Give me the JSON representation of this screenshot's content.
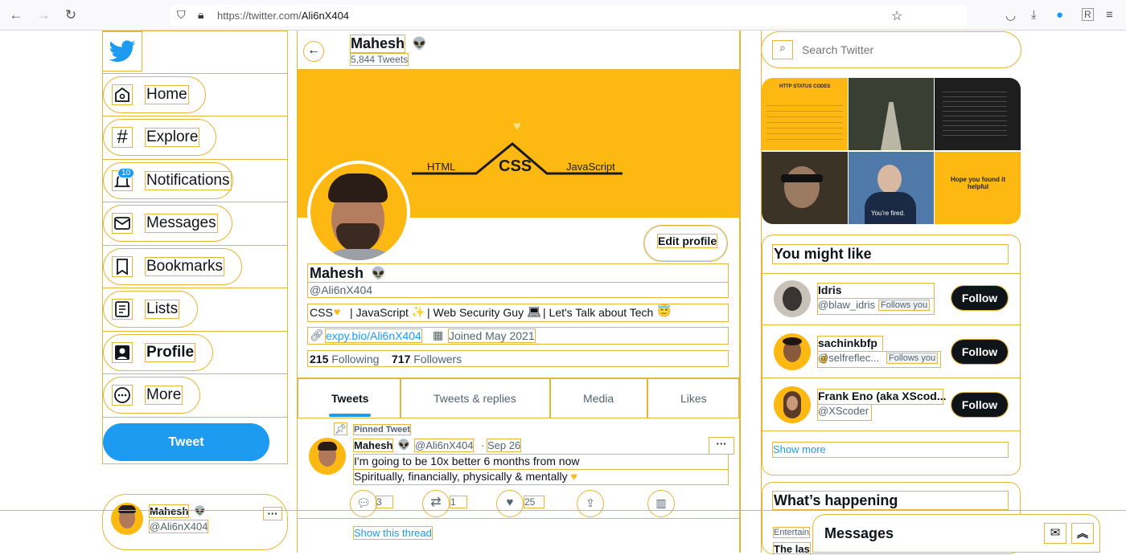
{
  "browser": {
    "url_host": "https://twitter.com/",
    "url_path": "Ali6nX404"
  },
  "nav": {
    "items": [
      {
        "label": "Home",
        "icon": "home-icon"
      },
      {
        "label": "Explore",
        "icon": "hashtag-icon"
      },
      {
        "label": "Notifications",
        "icon": "bell-icon",
        "badge": "10"
      },
      {
        "label": "Messages",
        "icon": "envelope-icon"
      },
      {
        "label": "Bookmarks",
        "icon": "bookmark-icon"
      },
      {
        "label": "Lists",
        "icon": "list-icon"
      },
      {
        "label": "Profile",
        "icon": "person-icon"
      },
      {
        "label": "More",
        "icon": "more-circle-icon"
      }
    ],
    "tweet_label": "Tweet"
  },
  "account": {
    "name": "Mahesh",
    "handle": "@Ali6nX404"
  },
  "profile_header": {
    "name": "Mahesh",
    "tweet_count": "5,844 Tweets"
  },
  "banner": {
    "left_word": "HTML",
    "center_word": "CSS",
    "right_word": "JavaScript"
  },
  "profile": {
    "edit_label": "Edit profile",
    "name": "Mahesh",
    "handle": "@Ali6nX404",
    "bio_1": "CSS",
    "bio_2": "| JavaScript",
    "bio_3": "| Web Security Guy",
    "bio_4": "| Let's Talk about Tech",
    "link": "expy.bio/Ali6nX404",
    "joined": "Joined May 2021",
    "following_count": "215",
    "following_label": "Following",
    "followers_count": "717",
    "followers_label": "Followers"
  },
  "tabs": [
    "Tweets",
    "Tweets & replies",
    "Media",
    "Likes"
  ],
  "tweet": {
    "pinned_label": "Pinned Tweet",
    "name": "Mahesh",
    "handle": "@Ali6nX404",
    "separator": "·",
    "date": "Sep 26",
    "line1": "I'm going to be 10x better 6 months from now",
    "line2": "Spiritually, financially, physically & mentally",
    "replies": "3",
    "retweets": "1",
    "likes": "25",
    "show_thread": "Show this thread"
  },
  "search": {
    "placeholder": "Search Twitter"
  },
  "media_grid": {
    "tile1_title": "HTTP STATUS CODES",
    "tile3_caption": "You're fired.",
    "tile4_text": "Hope you found it helpful"
  },
  "suggestions": {
    "title": "You might like",
    "follow_label": "Follow",
    "follows_you_label": "Follows you",
    "users": [
      {
        "name": "Idris",
        "handle": "@blaw_idris",
        "follows_you": true
      },
      {
        "name": "sachinkbfp",
        "handle": "@selfreflec...",
        "follows_you": true
      },
      {
        "name": "Frank Eno (aka XScod...",
        "handle": "@XScoder",
        "follows_you": false
      }
    ],
    "show_more": "Show more"
  },
  "trends": {
    "title": "What’s happening",
    "item_category": "Entertain",
    "item_title": "The las"
  },
  "messages_drawer": {
    "title": "Messages"
  },
  "colors": {
    "accent": "#1d9bf0",
    "banner": "#fdb812",
    "outline": "#e8b53a"
  }
}
